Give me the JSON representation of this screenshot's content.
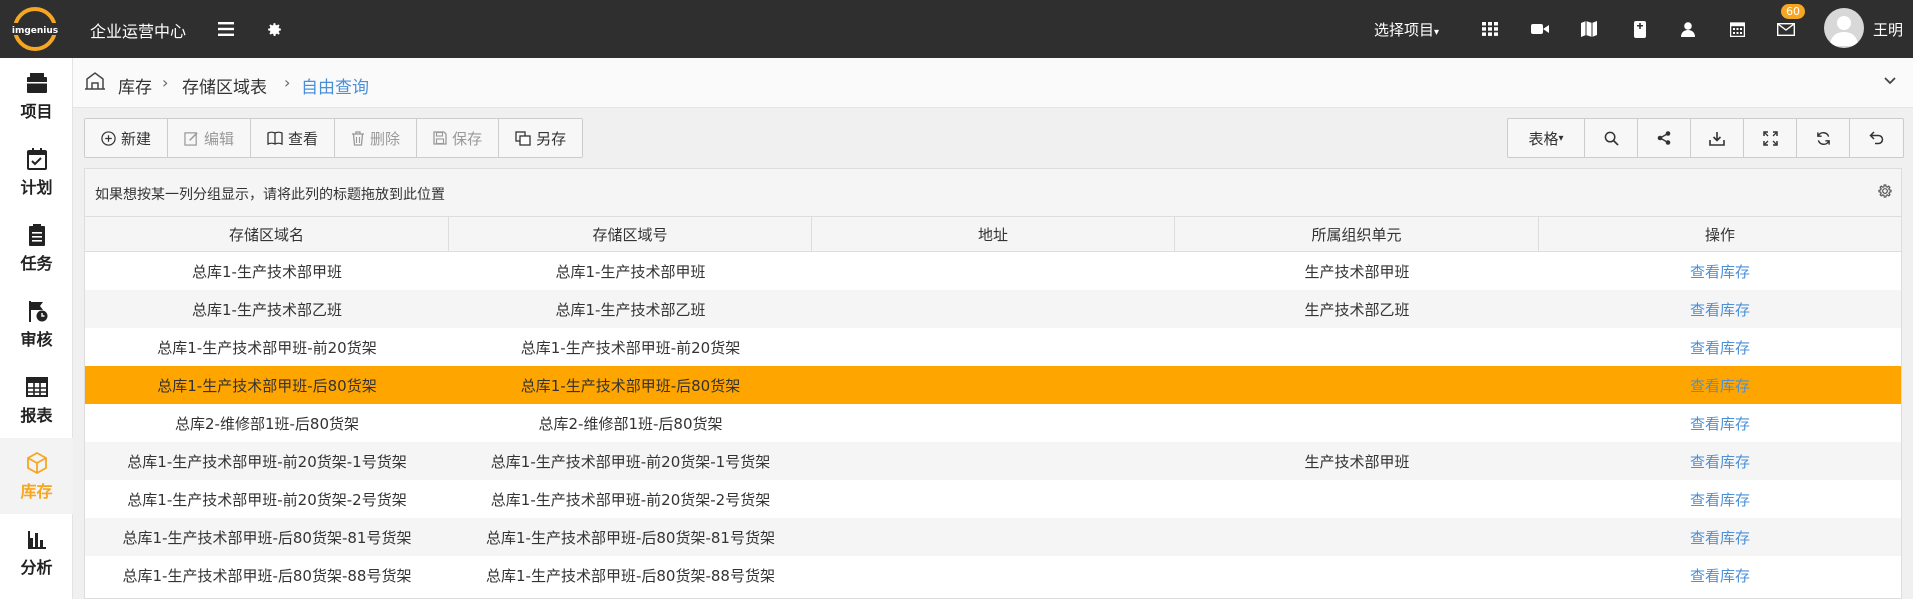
{
  "topbar": {
    "logo_text": "imgenius",
    "app_title": "企业运营中心",
    "project_select": "选择项目",
    "badge_count": "60",
    "user_name": "王明"
  },
  "sidebar": {
    "items": [
      {
        "label": "项目",
        "icon": "briefcase-icon"
      },
      {
        "label": "计划",
        "icon": "calendar-check-icon"
      },
      {
        "label": "任务",
        "icon": "clipboard-icon"
      },
      {
        "label": "审核",
        "icon": "flag-clock-icon"
      },
      {
        "label": "报表",
        "icon": "table-icon"
      },
      {
        "label": "库存",
        "icon": "box-icon",
        "active": true
      },
      {
        "label": "分析",
        "icon": "bar-chart-icon"
      }
    ]
  },
  "breadcrumb": {
    "items": [
      "库存",
      "存储区域表",
      "自由查询"
    ]
  },
  "toolbar": {
    "new_label": "新建",
    "edit_label": "编辑",
    "view_label": "查看",
    "delete_label": "删除",
    "save_label": "保存",
    "save_as_label": "另存",
    "table_label": "表格"
  },
  "grid": {
    "group_hint": "如果想按某一列分组显示，请将此列的标题拖放到此位置",
    "columns": [
      "存储区域名",
      "存储区域号",
      "地址",
      "所属组织单元",
      "操作"
    ],
    "rows": [
      [
        "总库1-生产技术部甲班",
        "总库1-生产技术部甲班",
        "",
        "生产技术部甲班",
        "查看库存"
      ],
      [
        "总库1-生产技术部乙班",
        "总库1-生产技术部乙班",
        "",
        "生产技术部乙班",
        "查看库存"
      ],
      [
        "总库1-生产技术部甲班-前20货架",
        "总库1-生产技术部甲班-前20货架",
        "",
        "",
        "查看库存"
      ],
      [
        "总库1-生产技术部甲班-后80货架",
        "总库1-生产技术部甲班-后80货架",
        "",
        "",
        "查看库存"
      ],
      [
        "总库2-维修部1班-后80货架",
        "总库2-维修部1班-后80货架",
        "",
        "",
        "查看库存"
      ],
      [
        "总库1-生产技术部甲班-前20货架-1号货架",
        "总库1-生产技术部甲班-前20货架-1号货架",
        "",
        "生产技术部甲班",
        "查看库存"
      ],
      [
        "总库1-生产技术部甲班-前20货架-2号货架",
        "总库1-生产技术部甲班-前20货架-2号货架",
        "",
        "",
        "查看库存"
      ],
      [
        "总库1-生产技术部甲班-后80货架-81号货架",
        "总库1-生产技术部甲班-后80货架-81号货架",
        "",
        "",
        "查看库存"
      ],
      [
        "总库1-生产技术部甲班-后80货架-88号货架",
        "总库1-生产技术部甲班-后80货架-88号货架",
        "",
        "",
        "查看库存"
      ]
    ],
    "selected_row": 3
  },
  "colors": {
    "topbar_bg": "#2f2f2f",
    "accent": "#f5a623",
    "selected_row": "#ffa500",
    "link": "#4a90d9"
  }
}
